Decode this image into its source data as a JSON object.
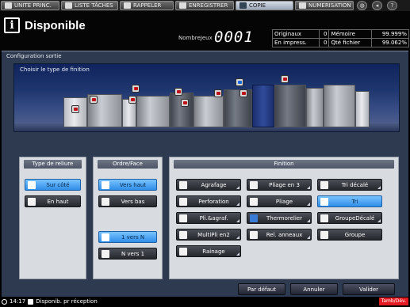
{
  "tabs": [
    {
      "label": "UNITE PRINC.",
      "icon": "home-icon"
    },
    {
      "label": "LISTE TÂCHES",
      "icon": "list-icon"
    },
    {
      "label": "RAPPELER",
      "icon": "recall-icon"
    },
    {
      "label": "ENREGISTRER",
      "icon": "save-icon"
    },
    {
      "label": "COPIE",
      "icon": "copy-icon"
    },
    {
      "label": "NUMERISATION",
      "icon": "scan-icon"
    }
  ],
  "active_tab": "COPIE",
  "header": {
    "status": "Disponible",
    "copies_label": "NombreJeux",
    "copies_value": "0001"
  },
  "counters": {
    "originals_label": "Originaux",
    "originals_value": "0",
    "printing_label": "En impress.",
    "printing_value": "0",
    "memory_label": "Mémoire",
    "memory_value": "99.999%",
    "file_label": "Qté fichier",
    "file_value": "99.062%"
  },
  "main": {
    "title": "Configuration sortie",
    "prompt": "Choisir le type de finition"
  },
  "binding": {
    "title": "Type de reliure",
    "options": [
      {
        "label": "Sur côté",
        "selected": true
      },
      {
        "label": "En haut",
        "selected": false
      }
    ]
  },
  "order": {
    "title": "Ordre/Face",
    "options": [
      {
        "label": "Vers haut",
        "selected": true
      },
      {
        "label": "Vers bas",
        "selected": false
      },
      {
        "label": "1 vers N",
        "selected": true
      },
      {
        "label": "N vers 1",
        "selected": false
      }
    ]
  },
  "finishing": {
    "title": "Finition",
    "options": [
      {
        "label": "Agrafage",
        "selected": false
      },
      {
        "label": "Pliage en 3",
        "selected": false
      },
      {
        "label": "Tri décalé",
        "selected": false
      },
      {
        "label": "Perforation",
        "selected": false
      },
      {
        "label": "Pliage",
        "selected": false
      },
      {
        "label": "Tri",
        "selected": true
      },
      {
        "label": "Pli.&agraf.",
        "selected": false
      },
      {
        "label": "Thermorelier",
        "selected": false
      },
      {
        "label": "GroupeDécalé",
        "selected": false
      },
      {
        "label": "MultiPli en2",
        "selected": false
      },
      {
        "label": "Rel. anneaux",
        "selected": false
      },
      {
        "label": "Groupe",
        "selected": false
      },
      {
        "label": "Rainage",
        "selected": false
      }
    ]
  },
  "footer": {
    "default_label": "Par défaut",
    "cancel_label": "Annuler",
    "ok_label": "Valider"
  },
  "statusbar": {
    "time": "14:17",
    "job_status": "Disponib. pr réception",
    "toner": "Tamb/Dév."
  },
  "colors": {
    "selected_button": "#2f8ee8",
    "alert": "#e51b24",
    "panel_background": "#2d3a4f"
  }
}
